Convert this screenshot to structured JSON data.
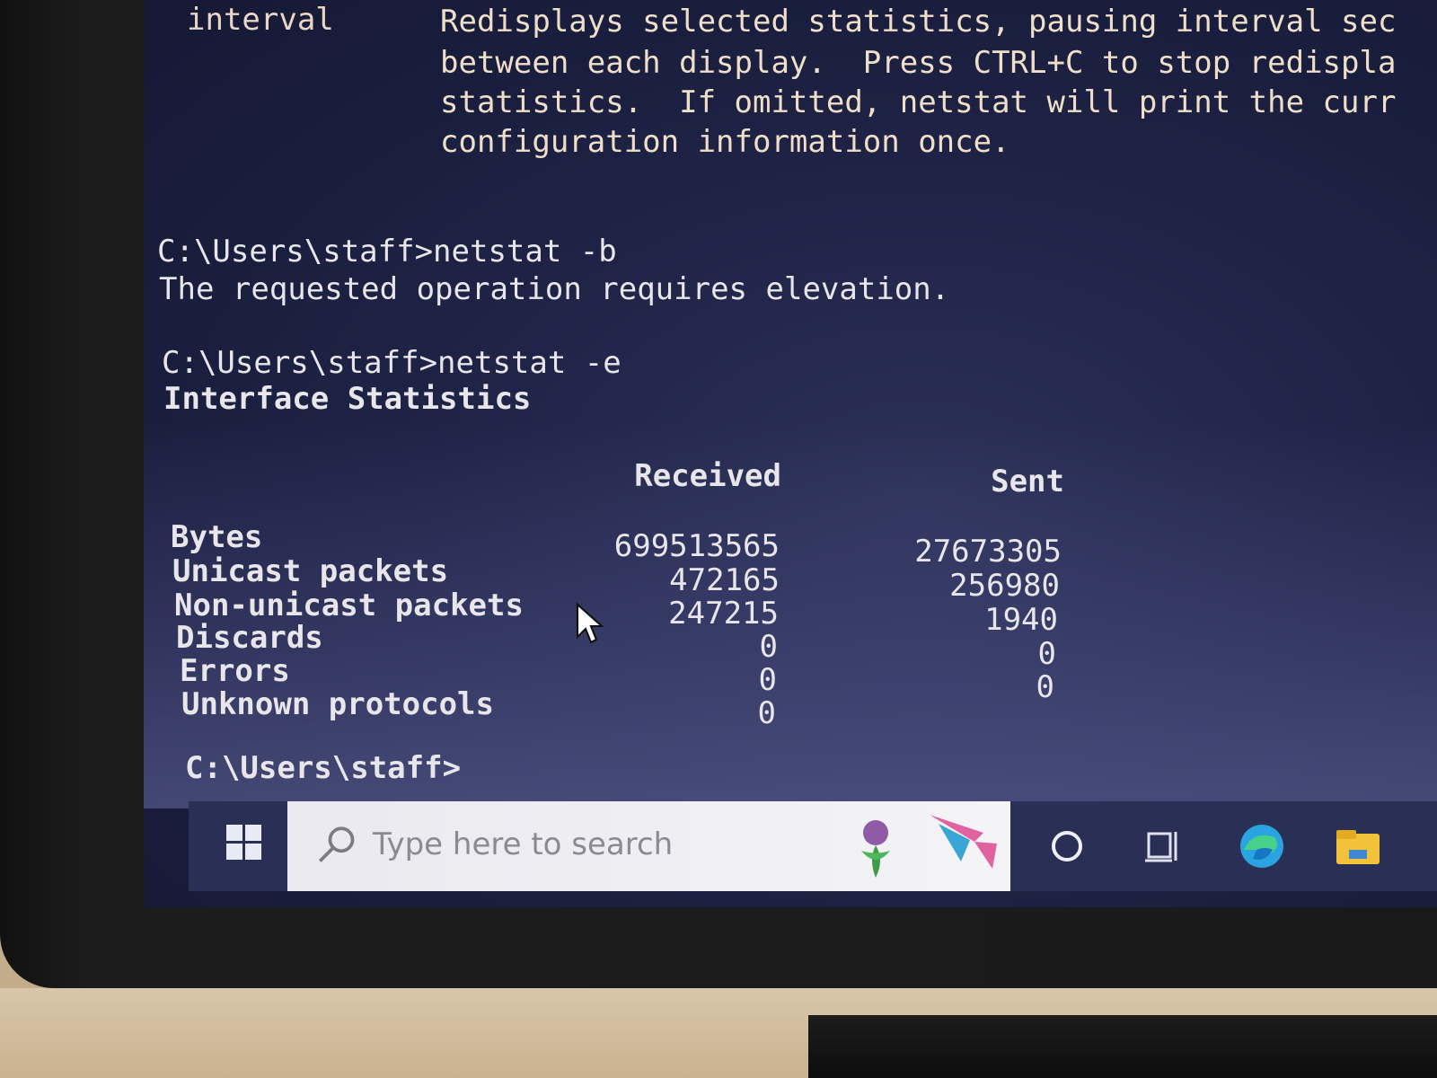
{
  "help": {
    "key": "interval",
    "lines": [
      "Redisplays selected statistics, pausing interval sec",
      "between each display.  Press CTRL+C to stop redispla",
      "statistics.  If omitted, netstat will print the curr",
      "configuration information once."
    ]
  },
  "session": [
    {
      "prompt": "C:\\Users\\staff>netstat -b",
      "output": "The requested operation requires elevation."
    },
    {
      "prompt": "C:\\Users\\staff>netstat -e",
      "output": "Interface Statistics"
    }
  ],
  "stats": {
    "header_received": "Received",
    "header_sent": "Sent",
    "rows": [
      {
        "label": "Bytes",
        "received": "699513565",
        "sent": "27673305"
      },
      {
        "label": "Unicast packets",
        "received": "472165",
        "sent": "256980"
      },
      {
        "label": "Non-unicast packets",
        "received": "247215",
        "sent": "1940"
      },
      {
        "label": "Discards",
        "received": "0",
        "sent": "0"
      },
      {
        "label": "Errors",
        "received": "0",
        "sent": "0"
      },
      {
        "label": "Unknown protocols",
        "received": "0",
        "sent": ""
      }
    ]
  },
  "final_prompt": "C:\\Users\\staff>",
  "taskbar": {
    "search_placeholder": "Type here to search",
    "icons": [
      "windows-start-icon",
      "search-icon",
      "cortana-icon",
      "task-view-icon",
      "edge-icon",
      "file-explorer-icon"
    ]
  },
  "colors": {
    "console_bg": "#1f2346",
    "console_text": "#e8e6ea",
    "taskbar_bg": "#2a2f56",
    "search_bg": "#f0f0f4"
  }
}
